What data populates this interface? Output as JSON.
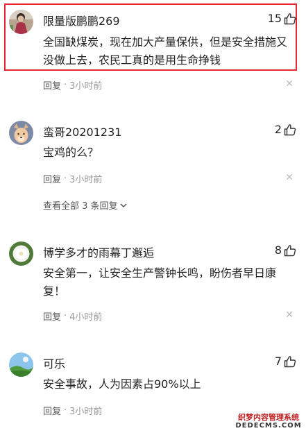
{
  "comments": [
    {
      "username": "限量版鹏鹏269",
      "likes": "15",
      "content": "全国缺煤炭，现在加大产量保供，但是安全措施又没做上去，农民工真的是用生命挣钱",
      "reply_label": "回复",
      "separator": "·",
      "time": "3小时前",
      "avatar_icon": "person-photo-avatar",
      "highlighted": true
    },
    {
      "username": "蛮哥20201231",
      "likes": "2",
      "content": "宝鸡的么？",
      "reply_label": "回复",
      "separator": "·",
      "time": "3小时前",
      "view_all": "查看全部 3 条回复",
      "avatar_icon": "dog-avatar"
    },
    {
      "username": "博学多才的雨幕丁邂逅",
      "likes": "8",
      "content": "安全第一，让安全生产警钟长鸣，盼伤者早日康复！",
      "reply_label": "回复",
      "separator": "·",
      "time": "4小时前",
      "avatar_icon": "flower-avatar"
    },
    {
      "username": "可乐",
      "likes": "7",
      "content": "安全事故，人为因素占90%以上",
      "reply_label": "回复",
      "separator": "·",
      "time": "3小时前",
      "avatar_icon": "landscape-avatar"
    }
  ],
  "watermark": {
    "line1": "织梦内容管理系统",
    "line2": "DEDECMS.COM"
  },
  "colors": {
    "highlight": "#e8262f",
    "text": "#222222",
    "muted": "#999999"
  }
}
